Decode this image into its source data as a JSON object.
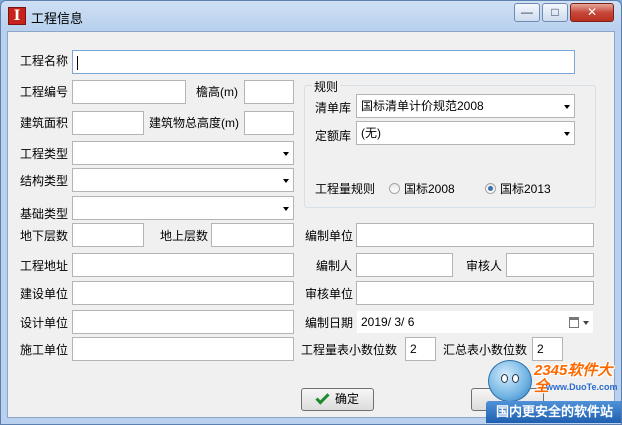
{
  "window": {
    "title": "工程信息",
    "app_icon_letter": "I",
    "buttons": {
      "minimize": "—",
      "maximize": "□",
      "close": "✕"
    }
  },
  "form": {
    "project_name": {
      "label": "工程名称",
      "value": ""
    },
    "project_number": {
      "label": "工程编号",
      "value": ""
    },
    "eave_height": {
      "label": "檐高(m)",
      "value": ""
    },
    "building_area": {
      "label": "建筑面积",
      "value": ""
    },
    "building_total_height": {
      "label": "建筑物总高度(m)",
      "value": ""
    },
    "project_type": {
      "label": "工程类型",
      "value": ""
    },
    "structure_type": {
      "label": "结构类型",
      "value": ""
    },
    "foundation_type": {
      "label": "基础类型",
      "value": ""
    },
    "underground_floors": {
      "label": "地下层数",
      "value": ""
    },
    "above_ground_floors": {
      "label": "地上层数",
      "value": ""
    },
    "compiling_unit": {
      "label": "编制单位",
      "value": ""
    },
    "project_address": {
      "label": "工程地址",
      "value": ""
    },
    "compiler": {
      "label": "编制人",
      "value": ""
    },
    "reviewer": {
      "label": "审核人",
      "value": ""
    },
    "construction_unit": {
      "label": "建设单位",
      "value": ""
    },
    "review_unit": {
      "label": "审核单位",
      "value": ""
    },
    "design_unit": {
      "label": "设计单位",
      "value": ""
    },
    "compile_date": {
      "label": "编制日期",
      "value": "2019/  3/  6"
    },
    "builder_unit": {
      "label": "施工单位",
      "value": ""
    },
    "quantity_decimals": {
      "label": "工程量表小数位数",
      "value": "2"
    },
    "summary_decimals": {
      "label": "汇总表小数位数",
      "value": "2"
    }
  },
  "rules": {
    "group_title": "规则",
    "list_library": {
      "label": "清单库",
      "value": "国标清单计价规范2008"
    },
    "quota_library": {
      "label": "定额库",
      "value": "(无)"
    },
    "quantity_rule": {
      "label": "工程量规则",
      "options": [
        {
          "label": "国标2008",
          "selected": false
        },
        {
          "label": "国标2013",
          "selected": true
        }
      ]
    }
  },
  "actions": {
    "ok": "确定"
  },
  "watermark": {
    "brand": "2345软件大全",
    "url": "www.DuoTe.com",
    "slogan": "国内更安全的软件站"
  }
}
